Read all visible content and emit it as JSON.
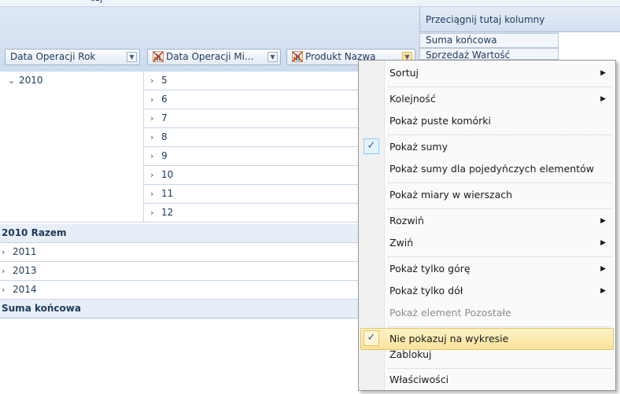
{
  "top_text": "tej",
  "pivot": {
    "drop_hint": "Przeciągnij tutaj kolumny",
    "data_headers": [
      "Suma końcowa",
      "Sprzedaż Wartość"
    ],
    "fields": [
      {
        "label": "Data Operacji Rok",
        "icon": ""
      },
      {
        "label": "Data Operacji Mi...",
        "icon": "chart-icon"
      },
      {
        "label": "Produkt Nazwa",
        "icon": "chart-icon"
      }
    ],
    "year_2010": "2010",
    "months": [
      "5",
      "6",
      "7",
      "8",
      "9",
      "10",
      "11",
      "12"
    ],
    "total_2010": "2010 Razem",
    "years": [
      "2011",
      "2013",
      "2014"
    ],
    "grand_total": "Suma końcowa"
  },
  "context_menu": {
    "items": [
      {
        "label": "Sortuj",
        "submenu": true
      },
      {
        "label": "Kolejność",
        "submenu": true
      },
      {
        "label": "Pokaż puste komórki"
      },
      {
        "label": "Pokaż sumy",
        "checked": true
      },
      {
        "label": "Pokaż sumy dla pojedyńczych elementów"
      },
      {
        "label": "Pokaż miary w wierszach"
      },
      {
        "label": "Rozwiń",
        "submenu": true
      },
      {
        "label": "Zwiń",
        "submenu": true
      },
      {
        "label": "Pokaż tylko górę",
        "submenu": true
      },
      {
        "label": "Pokaż tylko dół",
        "submenu": true
      },
      {
        "label": "Pokaż element Pozostałe",
        "disabled": true
      },
      {
        "label": "Nie pokazuj na wykresie",
        "checked": true,
        "highlighted": true
      },
      {
        "label": "Zablokuj"
      },
      {
        "label": "Właściwości"
      }
    ]
  },
  "colors": {
    "header_bg": "#dfe8f5",
    "accent_text": "#1e395b",
    "highlight": "#fbe39b"
  }
}
